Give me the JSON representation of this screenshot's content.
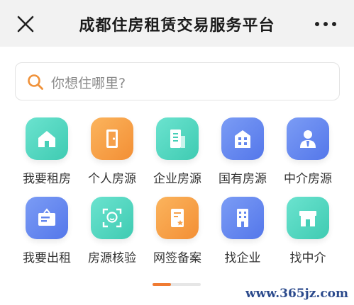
{
  "header": {
    "title": "成都住房租赁交易服务平台",
    "close_icon": "close-icon",
    "more_icon": "more-icon"
  },
  "search": {
    "placeholder": "你想住哪里?",
    "icon": "search-icon",
    "icon_color": "#f0923a"
  },
  "services": [
    {
      "label": "我要租房",
      "icon": "house-icon",
      "color": "teal"
    },
    {
      "label": "个人房源",
      "icon": "door-icon",
      "color": "orange"
    },
    {
      "label": "企业房源",
      "icon": "building-icon",
      "color": "teal"
    },
    {
      "label": "国有房源",
      "icon": "office-icon",
      "color": "blue"
    },
    {
      "label": "中介房源",
      "icon": "agent-icon",
      "color": "blue"
    },
    {
      "label": "我要出租",
      "icon": "signboard-icon",
      "color": "blue"
    },
    {
      "label": "房源核验",
      "icon": "face-scan-icon",
      "color": "teal"
    },
    {
      "label": "网签备案",
      "icon": "contract-icon",
      "color": "orange"
    },
    {
      "label": "找企业",
      "icon": "enterprise-icon",
      "color": "blue"
    },
    {
      "label": "找中介",
      "icon": "storefront-icon",
      "color": "teal"
    }
  ],
  "colors": {
    "teal": "#4fd6bf",
    "orange": "#f7a048",
    "blue": "#5f86f0",
    "pager_active": "#f07b32"
  },
  "pager": {
    "pages": 2,
    "current": 1
  },
  "watermark": "www.365jz.com"
}
